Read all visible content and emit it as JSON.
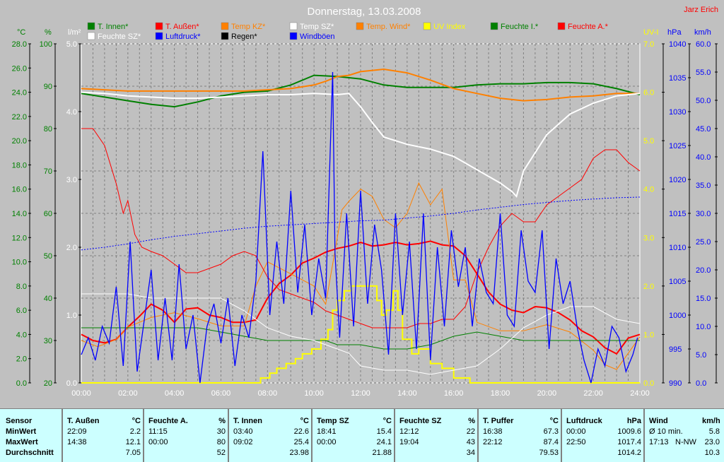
{
  "title": "Donnerstag, 13.03.2008",
  "author": "Jarz Erich",
  "colors": {
    "T_innen": "#008000",
    "T_aussen": "#ff0000",
    "Temp_KZ": "#ff8000",
    "Temp_SZ": "#ffffff",
    "Temp_Wind": "#ff8000",
    "UV": "#ffff00",
    "Feuchte_I": "#008000",
    "Feuchte_A": "#ff0000",
    "Feuchte_SZ": "#ffffff",
    "Luftdruck": "#0000ff",
    "Regen": "#000000",
    "Windboeen": "#0000ff"
  },
  "legend_row1": [
    "T. Innen*",
    "T. Außen*",
    "Temp KZ*",
    "Temp SZ*",
    "Temp. Wind*",
    "UV Index",
    "Feuchte I.*",
    "Feuchte A.*"
  ],
  "legend_row2": [
    "Feuchte SZ*",
    "Luftdruck*",
    "Regen*",
    "Windböen"
  ],
  "axis_units": {
    "temp": "°C",
    "hum": "%",
    "rain": "l/m²",
    "uv": "UV-I",
    "press": "hPa",
    "wind": "km/h"
  },
  "chart_data": {
    "type": "line",
    "title": "Donnerstag, 13.03.2008",
    "grid": true,
    "legend": "top",
    "x_ticks": [
      "00:00",
      "02:00",
      "04:00",
      "06:00",
      "08:00",
      "10:00",
      "12:00",
      "14:00",
      "16:00",
      "18:00",
      "20:00",
      "22:00",
      "24:00"
    ],
    "x_range": [
      0,
      24
    ],
    "axes": {
      "temp": {
        "label": "°C",
        "range": [
          0,
          28
        ],
        "ticks": [
          "0.0",
          "2.0",
          "4.0",
          "6.0",
          "8.0",
          "10.0",
          "12.0",
          "14.0",
          "16.0",
          "18.0",
          "20.0",
          "22.0",
          "24.0",
          "26.0",
          "28.0"
        ]
      },
      "hum": {
        "label": "%",
        "range": [
          20,
          100
        ],
        "ticks": [
          "20",
          "30",
          "40",
          "50",
          "60",
          "70",
          "80",
          "90",
          "100"
        ]
      },
      "rain": {
        "label": "l/m²",
        "range": [
          0,
          5
        ],
        "ticks": [
          "0.0",
          "1.0",
          "2.0",
          "3.0",
          "4.0",
          "5.0"
        ]
      },
      "uv": {
        "label": "UV-I",
        "range": [
          0,
          7
        ],
        "ticks": [
          "0.0",
          "1.0",
          "2.0",
          "3.0",
          "4.0",
          "5.0",
          "6.0",
          "7.0"
        ]
      },
      "press": {
        "label": "hPa",
        "range": [
          990,
          1040
        ],
        "ticks": [
          "990",
          "995",
          "1000",
          "1005",
          "1010",
          "1015",
          "1020",
          "1025",
          "1030",
          "1035",
          "1040"
        ]
      },
      "wind": {
        "label": "km/h",
        "range": [
          0,
          60
        ],
        "ticks": [
          "0.0",
          "5.0",
          "10.0",
          "15.0",
          "20.0",
          "25.0",
          "30.0",
          "35.0",
          "40.0",
          "45.0",
          "50.0",
          "55.0",
          "60.0"
        ]
      }
    },
    "series": [
      {
        "name": "T. Innen*",
        "axis": "temp",
        "color": "#008000",
        "width": 2,
        "x": [
          0,
          1,
          2,
          3,
          4,
          5,
          6,
          7,
          8,
          9,
          10,
          11,
          12,
          13,
          14,
          15,
          16,
          17,
          18,
          19,
          20,
          21,
          22,
          23,
          24
        ],
        "y": [
          23.9,
          23.6,
          23.3,
          23.0,
          22.8,
          23.2,
          23.7,
          24.0,
          24.1,
          24.6,
          25.4,
          25.3,
          25.1,
          24.6,
          24.4,
          24.4,
          24.4,
          24.6,
          24.7,
          24.7,
          24.8,
          24.8,
          24.7,
          24.3,
          23.8
        ]
      },
      {
        "name": "T. Außen*",
        "axis": "temp",
        "color": "#ff0000",
        "width": 2,
        "x": [
          0,
          0.5,
          1,
          1.5,
          2,
          2.5,
          3,
          3.5,
          4,
          4.5,
          5,
          5.5,
          6,
          6.5,
          7,
          7.5,
          8,
          8.5,
          9,
          9.5,
          10,
          10.5,
          11,
          11.5,
          12,
          12.5,
          13,
          13.5,
          14,
          14.5,
          15,
          15.5,
          16,
          16.5,
          17,
          17.5,
          18,
          18.5,
          19,
          19.5,
          20,
          20.5,
          21,
          21.5,
          22,
          22.5,
          23,
          23.5,
          24
        ],
        "y": [
          4.0,
          3.5,
          3.3,
          3.6,
          4.6,
          5.5,
          6.5,
          6.0,
          5.0,
          6.1,
          6.2,
          5.6,
          5.4,
          5.0,
          5.0,
          5.2,
          7.0,
          8.2,
          8.9,
          9.9,
          10.3,
          10.8,
          11.1,
          11.3,
          11.6,
          11.3,
          11.4,
          11.6,
          11.4,
          11.5,
          11.7,
          11.4,
          11.3,
          10.5,
          9.0,
          7.5,
          6.5,
          6.0,
          5.8,
          6.3,
          6.2,
          5.8,
          5.2,
          4.3,
          3.8,
          2.9,
          2.4,
          3.7,
          4.0
        ]
      },
      {
        "name": "Temp KZ*",
        "axis": "temp",
        "color": "#ff8000",
        "width": 2,
        "x": [
          0,
          1,
          2,
          3,
          4,
          5,
          6,
          7,
          8,
          9,
          10,
          10.5,
          11,
          11.5,
          12,
          13,
          14,
          15,
          16,
          17,
          18,
          19,
          20,
          21,
          22,
          23,
          24
        ],
        "y": [
          24.3,
          24.2,
          24.1,
          24.1,
          24.1,
          24.1,
          24.1,
          24.1,
          24.2,
          24.3,
          24.6,
          24.9,
          25.3,
          25.4,
          25.7,
          25.9,
          25.6,
          25.0,
          24.3,
          23.9,
          23.5,
          23.3,
          23.4,
          23.6,
          23.7,
          23.9,
          23.9
        ]
      },
      {
        "name": "Temp SZ*",
        "axis": "temp",
        "color": "#ffffff",
        "width": 2,
        "x": [
          0,
          1,
          2,
          3,
          4,
          5,
          6,
          7,
          8,
          9,
          10,
          11,
          11.5,
          12,
          12.5,
          13,
          14,
          15,
          16,
          17,
          18,
          18.5,
          18.7,
          19,
          20,
          21,
          22,
          23,
          24
        ],
        "y": [
          24.0,
          23.9,
          23.7,
          23.6,
          23.5,
          23.5,
          23.6,
          23.7,
          23.8,
          23.8,
          23.9,
          23.8,
          23.9,
          22.8,
          21.5,
          20.3,
          19.7,
          19.3,
          18.7,
          17.6,
          16.5,
          15.8,
          15.4,
          17.5,
          20.5,
          22.2,
          23.1,
          23.7,
          23.9
        ]
      },
      {
        "name": "Temp. Wind*",
        "axis": "temp",
        "color": "#ff8000",
        "width": 1,
        "x": [
          0,
          0.7,
          1,
          1.5,
          2,
          3,
          4,
          5,
          6,
          7,
          7.5,
          8,
          9,
          10,
          10.5,
          11,
          11.2,
          11.5,
          12,
          12.5,
          13,
          13.5,
          14,
          14.5,
          15,
          15.5,
          16,
          16.5,
          17,
          18,
          19,
          20,
          21,
          22,
          22.5,
          23,
          24
        ],
        "y": [
          3.5,
          3.0,
          3.2,
          3.6,
          4.6,
          5.4,
          5.8,
          5.3,
          4.7,
          4.7,
          8.0,
          10.0,
          9.0,
          8.0,
          6.5,
          12.0,
          14.3,
          15.0,
          16.0,
          15.4,
          13.5,
          12.8,
          14.0,
          16.5,
          14.7,
          16.0,
          8.5,
          8.5,
          5.0,
          4.3,
          4.3,
          4.8,
          4.2,
          2.7,
          1.5,
          1.1,
          3.8
        ]
      },
      {
        "name": "UV Index",
        "axis": "uv",
        "color": "#ffff00",
        "width": 2,
        "step": true,
        "x": [
          0,
          7.7,
          8.1,
          8.4,
          8.8,
          9.2,
          9.5,
          9.9,
          10.3,
          10.6,
          10.8,
          11.0,
          11.3,
          11.6,
          12.0,
          12.3,
          12.7,
          12.9,
          13.1,
          13.4,
          13.6,
          13.8,
          14.2,
          14.5,
          15.0,
          15.5,
          16.0,
          16.7,
          17.2,
          24
        ],
        "y": [
          0.0,
          0.1,
          0.2,
          0.3,
          0.4,
          0.5,
          0.6,
          0.7,
          0.9,
          1.1,
          1.5,
          1.7,
          1.9,
          2.0,
          2.0,
          2.0,
          1.7,
          1.4,
          1.5,
          1.9,
          1.5,
          0.9,
          0.6,
          0.7,
          0.4,
          0.3,
          0.1,
          0.0,
          0.0,
          0.0
        ]
      },
      {
        "name": "Feuchte I.*",
        "axis": "hum",
        "color": "#008000",
        "width": 1,
        "x": [
          0,
          1,
          2,
          3,
          4,
          5,
          6,
          7,
          8,
          9,
          10,
          10.5,
          11,
          12,
          13,
          14,
          15,
          16,
          17,
          18,
          19,
          20,
          21,
          22,
          23,
          24
        ],
        "y": [
          33,
          33,
          33,
          33,
          33,
          33,
          32,
          31,
          30,
          30,
          30,
          30,
          29,
          29,
          28,
          28,
          29,
          31,
          32,
          31,
          30,
          30,
          30,
          30,
          30,
          30
        ]
      },
      {
        "name": "Feuchte A.*",
        "axis": "hum",
        "color": "#ff0000",
        "width": 1,
        "x": [
          0,
          0.5,
          1,
          1.5,
          1.8,
          2,
          2.3,
          2.6,
          3,
          3.5,
          4,
          4.5,
          5,
          5.5,
          6,
          6.5,
          7,
          7.5,
          8,
          8.5,
          9,
          9.5,
          10,
          10.5,
          11,
          11.5,
          12,
          12.5,
          13,
          13.5,
          14,
          14.5,
          15,
          15.5,
          16,
          16.5,
          17,
          17.5,
          18,
          18.5,
          19,
          19.5,
          20,
          20.5,
          21,
          21.5,
          22,
          22.5,
          23,
          23.5,
          24
        ],
        "y": [
          80,
          80,
          76,
          67,
          60,
          63,
          55,
          52,
          51,
          50,
          48,
          46,
          46,
          47,
          48,
          50,
          51,
          50,
          45,
          42,
          41,
          40,
          39,
          37,
          36,
          35,
          34,
          33,
          33,
          33,
          33,
          34,
          34,
          35,
          35,
          38,
          46,
          52,
          57,
          60,
          58,
          58,
          62,
          64,
          66,
          68,
          73,
          75,
          75,
          72,
          70
        ]
      },
      {
        "name": "Feuchte SZ*",
        "axis": "hum",
        "color": "#ffffff",
        "width": 1,
        "x": [
          0,
          1,
          2,
          3,
          4,
          5,
          6,
          7,
          8,
          9,
          10,
          10.5,
          11,
          11.5,
          12,
          13,
          14,
          15,
          16,
          17,
          18,
          19,
          20,
          21,
          22,
          23,
          24
        ],
        "y": [
          41,
          41,
          41,
          40,
          40,
          40,
          40,
          37,
          33,
          31,
          30,
          29,
          28,
          27,
          24,
          23,
          23,
          22,
          23,
          24,
          28,
          33,
          36,
          38,
          38,
          35,
          34
        ]
      },
      {
        "name": "Luftdruck*",
        "axis": "press",
        "color": "#0000ff",
        "width": 1,
        "dashed": true,
        "x": [
          0,
          1,
          2,
          3,
          4,
          5,
          6,
          7,
          8,
          9,
          10,
          11,
          12,
          13,
          14,
          15,
          16,
          17,
          18,
          19,
          20,
          21,
          22,
          23,
          24
        ],
        "y": [
          1009.6,
          1010.0,
          1010.5,
          1011.1,
          1011.6,
          1012.0,
          1012.4,
          1012.8,
          1013.1,
          1013.3,
          1013.5,
          1013.7,
          1013.9,
          1014.0,
          1014.3,
          1014.6,
          1015.0,
          1015.5,
          1015.9,
          1016.3,
          1016.6,
          1016.9,
          1017.1,
          1017.3,
          1017.4
        ]
      },
      {
        "name": "Windböen",
        "axis": "wind",
        "color": "#0000ff",
        "width": 1.3,
        "x": [
          0,
          0.3,
          0.6,
          0.9,
          1.2,
          1.5,
          1.8,
          2.1,
          2.4,
          2.7,
          3.0,
          3.3,
          3.6,
          3.9,
          4.2,
          4.5,
          4.8,
          5.1,
          5.4,
          5.7,
          6.0,
          6.3,
          6.6,
          6.9,
          7.2,
          7.5,
          7.8,
          8.1,
          8.4,
          8.7,
          9.0,
          9.3,
          9.6,
          9.9,
          10.2,
          10.5,
          10.8,
          10.9,
          11.1,
          11.4,
          11.7,
          12.0,
          12.3,
          12.6,
          12.9,
          13.2,
          13.5,
          13.8,
          14.1,
          14.4,
          14.7,
          15.0,
          15.3,
          15.6,
          15.9,
          16.2,
          16.5,
          16.8,
          17.1,
          17.4,
          17.7,
          18.0,
          18.3,
          18.6,
          18.9,
          19.2,
          19.5,
          19.8,
          20.1,
          20.4,
          20.7,
          21.0,
          21.3,
          21.6,
          21.9,
          22.2,
          22.5,
          22.8,
          23.1,
          23.4,
          23.7,
          23.9
        ],
        "y": [
          5,
          8,
          4,
          10,
          7,
          17,
          3,
          25,
          2,
          11,
          20,
          4,
          15,
          4,
          21,
          6,
          12,
          0,
          10,
          14,
          7,
          15,
          3,
          12,
          8,
          18,
          41,
          12,
          25,
          14,
          34,
          16,
          28,
          12,
          22,
          15,
          55,
          23,
          8,
          30,
          10,
          34,
          14,
          28,
          20,
          5,
          30,
          12,
          25,
          6,
          30,
          4,
          24,
          10,
          27,
          17,
          24,
          10,
          22,
          16,
          14,
          30,
          12,
          10,
          27,
          18,
          16,
          27,
          6,
          22,
          14,
          18,
          10,
          4,
          0,
          6,
          3,
          10,
          8,
          2,
          5,
          8
        ]
      }
    ]
  },
  "table": {
    "row_labels": {
      "sensor": "Sensor",
      "min": "MinWert",
      "max": "MaxWert",
      "avg": "Durchschnitt"
    },
    "columns": [
      {
        "name": "T. Außen",
        "unit": "°C",
        "min_time": "22:09",
        "min_val": "2.2",
        "max_time": "14:38",
        "max_val": "12.1",
        "avg": "7.05"
      },
      {
        "name": "Feuchte A.",
        "unit": "%",
        "min_time": "11:15",
        "min_val": "30",
        "max_time": "00:00",
        "max_val": "80",
        "avg": "52"
      },
      {
        "name": "T. Innen",
        "unit": "°C",
        "min_time": "03:40",
        "min_val": "22.6",
        "max_time": "09:02",
        "max_val": "25.4",
        "avg": "23.98"
      },
      {
        "name": "Temp SZ",
        "unit": "°C",
        "min_time": "18:41",
        "min_val": "15.4",
        "max_time": "00:00",
        "max_val": "24.1",
        "avg": "21.88"
      },
      {
        "name": "Feuchte SZ",
        "unit": "%",
        "min_time": "12:12",
        "min_val": "22",
        "max_time": "19:04",
        "max_val": "43",
        "avg": "34"
      },
      {
        "name": "T. Puffer",
        "unit": "°C",
        "min_time": "16:38",
        "min_val": "67.3",
        "max_time": "22:12",
        "max_val": "87.4",
        "avg": "79.53"
      },
      {
        "name": "Luftdruck",
        "unit": "hPa",
        "min_time": "00:00",
        "min_val": "1009.6",
        "max_time": "22:50",
        "max_val": "1017.4",
        "avg": "1014.2"
      },
      {
        "name": "Wind",
        "unit": "km/h",
        "min_time": "Ø 10 min.",
        "min_val": "5.8",
        "max_time": "17:13",
        "max_dir": "N-NW",
        "max_val": "23.0",
        "avg": "10.3"
      }
    ]
  }
}
